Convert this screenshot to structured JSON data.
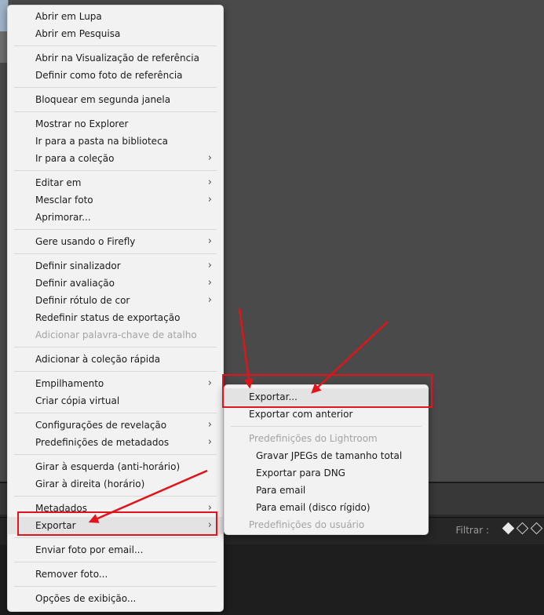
{
  "context_menu": {
    "groups": [
      [
        {
          "label": "Abrir em Lupa"
        },
        {
          "label": "Abrir em Pesquisa"
        }
      ],
      [
        {
          "label": "Abrir na Visualização de referência"
        },
        {
          "label": "Definir como foto de referência"
        }
      ],
      [
        {
          "label": "Bloquear em segunda janela"
        }
      ],
      [
        {
          "label": "Mostrar no Explorer"
        },
        {
          "label": "Ir para a pasta na biblioteca"
        },
        {
          "label": "Ir para a coleção",
          "submenu": true
        }
      ],
      [
        {
          "label": "Editar em",
          "submenu": true
        },
        {
          "label": "Mesclar foto",
          "submenu": true
        },
        {
          "label": "Aprimorar..."
        }
      ],
      [
        {
          "label": "Gere usando o Firefly",
          "submenu": true
        }
      ],
      [
        {
          "label": "Definir sinalizador",
          "submenu": true
        },
        {
          "label": "Definir avaliação",
          "submenu": true
        },
        {
          "label": "Definir rótulo de cor",
          "submenu": true
        },
        {
          "label": "Redefinir status de exportação"
        },
        {
          "label": "Adicionar palavra-chave de atalho",
          "disabled": true
        }
      ],
      [
        {
          "label": "Adicionar à coleção rápida"
        }
      ],
      [
        {
          "label": "Empilhamento",
          "submenu": true
        },
        {
          "label": "Criar cópia virtual"
        }
      ],
      [
        {
          "label": "Configurações de revelação",
          "submenu": true
        },
        {
          "label": "Predefinições de metadados",
          "submenu": true
        }
      ],
      [
        {
          "label": "Girar à esquerda (anti-horário)"
        },
        {
          "label": "Girar à direita (horário)"
        }
      ],
      [
        {
          "label": "Metadados",
          "submenu": true
        },
        {
          "label": "Exportar",
          "submenu": true,
          "highlighted": true
        }
      ],
      [
        {
          "label": "Enviar foto por email..."
        }
      ],
      [
        {
          "label": "Remover foto..."
        }
      ],
      [
        {
          "label": "Opções de exibição..."
        }
      ]
    ]
  },
  "export_submenu": {
    "groups": [
      [
        {
          "label": "Exportar...",
          "highlighted": true
        },
        {
          "label": "Exportar com anterior"
        }
      ],
      [
        {
          "label": "Predefinições do Lightroom",
          "disabled": true
        },
        {
          "label": "Gravar JPEGs de tamanho total",
          "indent": true
        },
        {
          "label": "Exportar para DNG",
          "indent": true
        },
        {
          "label": "Para email",
          "indent": true
        },
        {
          "label": "Para email (disco rígido)",
          "indent": true
        },
        {
          "label": "Predefinições do usuário",
          "disabled": true
        }
      ]
    ]
  },
  "filter_bar": {
    "label": "Filtrar :",
    "icons": [
      "flag-icon",
      "flag-icon",
      "flag-icon"
    ]
  },
  "icons": {
    "submenu_arrow": "chevron-right-icon"
  },
  "colors": {
    "annotation_red": "#e0141a",
    "menu_bg": "#f2f2f2",
    "highlight": "#e3e3e3",
    "disabled_text": "#a3a3a3"
  }
}
